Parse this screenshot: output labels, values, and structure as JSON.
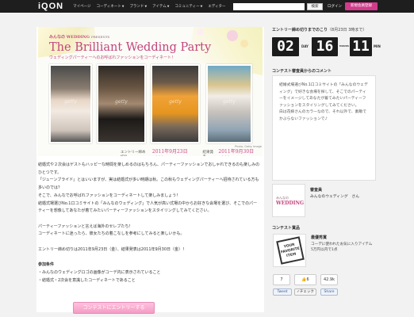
{
  "nav": {
    "logo": "iQON",
    "items": [
      {
        "label": "マイページ",
        "caret": ""
      },
      {
        "label": "コーディネート",
        "caret": "▼"
      },
      {
        "label": "ブランド",
        "caret": "▼"
      },
      {
        "label": "アイテム",
        "caret": "▼"
      },
      {
        "label": "コミュニティー",
        "caret": "▼"
      },
      {
        "label": "エディター",
        "caret": ""
      }
    ],
    "search_placeholder": "",
    "search_button": "検索",
    "login": "ログイン",
    "register": "新規会員登録"
  },
  "banner": {
    "brand": "みんなの WEDDING",
    "brand_suffix": "PRESENTS",
    "title": "The Brilliant Wedding Party",
    "subtitle": "ウェディングパーティーへのお呼ばれファッションをコーディネート！",
    "photo_credit": "Photo: Getty Image",
    "entry_deadline_label": "エントリー締め切り",
    "entry_deadline": "2011年9月23日（金）",
    "result_label": "結果発表",
    "result_date": "2011年9月30日（金）",
    "watermark": "getty"
  },
  "body": {
    "p1": "結婚式や２次会はゲストもハッピーな時間を楽しめるのはもちろん、パーティーファッションでおしゃれできるのも楽しみのひとつです。\n「ジューンブライド」とはいいますが、実は結婚式が多い時期は秋。この秋もウェディングパーティーへ招待されている方も多いのでは？\nそこで、みんなでお呼ばれファッションをコーディネートして楽しみましょう！\n結婚式場選びNo.1口コミサイトの「みんなのウェディング」で人気が高い式場の中からお好きな会場を選び、そこでのパーティーを想像してあなたが着てみたいパーティーファッションをスタイリングしてみてください。",
    "p2": "パーティーファッションと言えば海外のセレブたち！\nコーディネートに迷ったら、彼女たちの着こなしを参考にしてみると楽しいかも。",
    "p3": "エントリー締め切りは2011年9月23日（金）、結果発表は2011年9月30日（金）！",
    "cond_head": "参加条件",
    "cond_items": "・みんなのウェディングロゴの画像がコーデ内に表示されていること\n・結婚式・2次会を意識したコーディネートであること",
    "entry_button": "コンテストにエントリーする"
  },
  "countdown": {
    "title": "エントリー締め切りまでのこり",
    "subtitle": "（8月23日 3時まで）",
    "day": "02",
    "day_unit": "DAY",
    "hours": "16",
    "hours_unit": "HOURS",
    "minutes": "11",
    "minutes_unit": "MIN"
  },
  "comment": {
    "title": "コンテスト審査員からのコメント",
    "text": "結婚式場選びNo.1口コミサイトの「みんなのウェディング」で好きな会場を探して、そこでのパーティーをイメージしてあなたが着てみたいパーティーファッションをスタイリングしてみてください。\n白は花嫁さんのカラーなので、それ以外で、素敵でかぶらないファッションで♪"
  },
  "judge": {
    "role": "審査員",
    "name": "みんなのウェディング　さん",
    "logo_top": "みんなの",
    "logo_bottom": "WEDDING"
  },
  "prize": {
    "title": "コンテスト賞品",
    "stamp": "YOUR FAVORITE ITEM",
    "head": "最優秀賞",
    "desc": "コーデに使われたお気に入りアイテム5万円以内で1点"
  },
  "social": {
    "count_mixi": "7",
    "count_like": "6",
    "count_tweets": "42.9k",
    "tweet": "Tweet",
    "check": "✓チェック",
    "share": "Share"
  },
  "colors": {
    "nav_bg": "#1e1e1e",
    "accent_pink": "#c2467c",
    "register_pink": "#d23a8b"
  }
}
